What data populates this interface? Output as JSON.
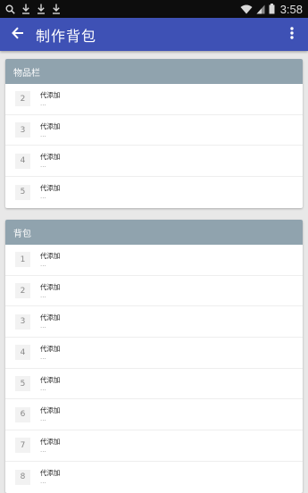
{
  "status_bar": {
    "time": "3:58",
    "icons": [
      "search-icon",
      "download-icon",
      "download-icon",
      "download-icon",
      "wifi-icon",
      "signal-icon",
      "battery-icon"
    ]
  },
  "app_bar": {
    "title": "制作背包",
    "back_icon": "arrow-back-icon",
    "menu_icon": "more-vert-icon"
  },
  "sections": [
    {
      "title": "物品栏",
      "items": [
        {
          "slot": "2",
          "name": "代添加",
          "sub": "..."
        },
        {
          "slot": "3",
          "name": "代添加",
          "sub": "..."
        },
        {
          "slot": "4",
          "name": "代添加",
          "sub": "..."
        },
        {
          "slot": "5",
          "name": "代添加",
          "sub": "..."
        }
      ]
    },
    {
      "title": "背包",
      "items": [
        {
          "slot": "1",
          "name": "代添加",
          "sub": "..."
        },
        {
          "slot": "2",
          "name": "代添加",
          "sub": "..."
        },
        {
          "slot": "3",
          "name": "代添加",
          "sub": "..."
        },
        {
          "slot": "4",
          "name": "代添加",
          "sub": "..."
        },
        {
          "slot": "5",
          "name": "代添加",
          "sub": "..."
        },
        {
          "slot": "6",
          "name": "代添加",
          "sub": "..."
        },
        {
          "slot": "7",
          "name": "代添加",
          "sub": "..."
        },
        {
          "slot": "8",
          "name": "代添加",
          "sub": "..."
        }
      ]
    }
  ],
  "colors": {
    "app_bar": "#3e51b5",
    "section_header": "#90a3ae",
    "status_bar": "#0d0d0d",
    "background": "#e8e8e8"
  }
}
